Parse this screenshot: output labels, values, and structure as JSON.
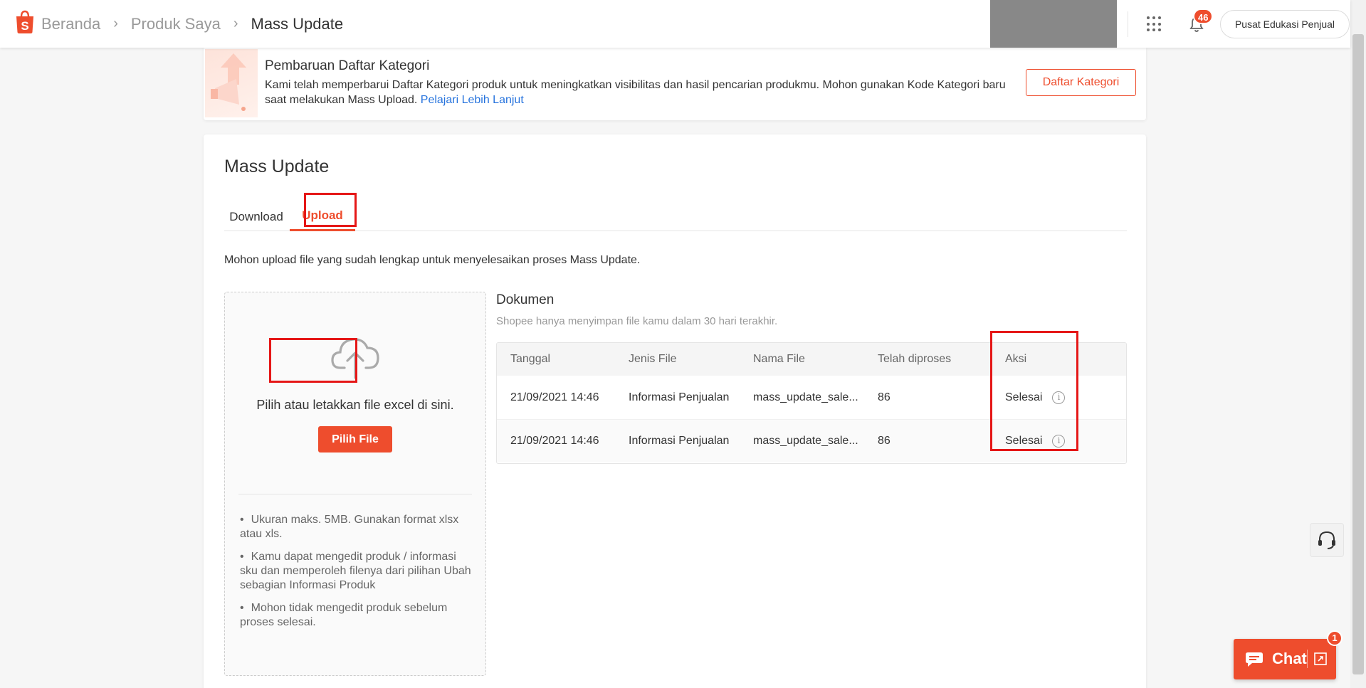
{
  "header": {
    "breadcrumbs": [
      "Beranda",
      "Produk Saya",
      "Mass Update"
    ],
    "notification_count": "46",
    "edu_button_label": "Pusat Edukasi Penjual"
  },
  "banner": {
    "title": "Pembaruan Daftar Kategori",
    "text": "Kami telah memperbarui Daftar Kategori produk untuk meningkatkan visibilitas dan hasil pencarian produkmu. Mohon gunakan Kode Kategori baru saat melakukan Mass Upload.",
    "link": "Pelajari Lebih Lanjut",
    "button": "Daftar Kategori"
  },
  "main": {
    "title": "Mass Update",
    "tabs": [
      {
        "label": "Download",
        "active": false
      },
      {
        "label": "Upload",
        "active": true
      }
    ],
    "instruction": "Mohon upload file yang sudah lengkap untuk menyelesaikan proses Mass Update."
  },
  "upload": {
    "drop_text": "Pilih atau letakkan file excel di sini.",
    "button": "Pilih File",
    "notes": [
      "Ukuran maks. 5MB. Gunakan format xlsx atau xls.",
      "Kamu dapat mengedit produk / informasi sku dan memperoleh filenya dari pilihan Ubah sebagian Informasi Produk",
      "Mohon tidak mengedit produk sebelum proses selesai."
    ]
  },
  "documents": {
    "title": "Dokumen",
    "subtitle": "Shopee hanya menyimpan file kamu dalam 30 hari terakhir.",
    "columns": [
      "Tanggal",
      "Jenis File",
      "Nama File",
      "Telah diproses",
      "Aksi"
    ],
    "rows": [
      {
        "date": "21/09/2021 14:46",
        "type": "Informasi Penjualan",
        "name": "mass_update_sale...",
        "processed": "86",
        "action": "Selesai"
      },
      {
        "date": "21/09/2021 14:46",
        "type": "Informasi Penjualan",
        "name": "mass_update_sale...",
        "processed": "86",
        "action": "Selesai"
      }
    ]
  },
  "chat": {
    "label": "Chat",
    "badge": "1"
  },
  "colors": {
    "brand": "#ee4d2d",
    "link": "#2673dd",
    "annotation": "#e51717"
  }
}
